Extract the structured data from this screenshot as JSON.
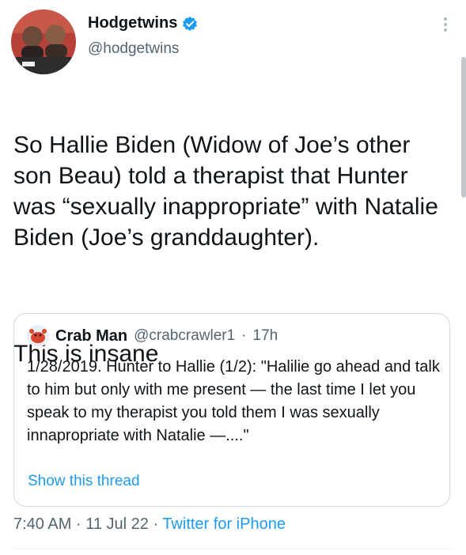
{
  "author": {
    "name": "Hodgetwins",
    "handle": "@hodgetwins"
  },
  "tweet": {
    "paragraph1": "So Hallie Biden (Widow of Joe’s other son Beau) told a therapist that Hunter was “sexually inappropriate” with Natalie Biden (Joe’s granddaughter).",
    "paragraph2": "This is insane"
  },
  "quoted_tweet": {
    "name": "Crab Man",
    "handle": "@crabcrawler1",
    "separator": "·",
    "time": "17h",
    "text": "1/28/2019. Hunter to Hallie (1/2): \"Halilie go ahead and talk to him but only with me present — the last time I let you speak to my therapist you told them I was sexually innapropriate with Natalie —....\"",
    "show_thread": "Show this thread"
  },
  "meta": {
    "time": "7:40 AM",
    "separator1": "·",
    "date": "11 Jul 22",
    "separator2": "·",
    "source": "Twitter for iPhone"
  },
  "colors": {
    "accent": "#1d9bf0",
    "secondary_text": "#536471",
    "border": "#cfd9de"
  },
  "icons": {
    "verified": "verified-badge-icon",
    "more": "more-options-icon"
  }
}
